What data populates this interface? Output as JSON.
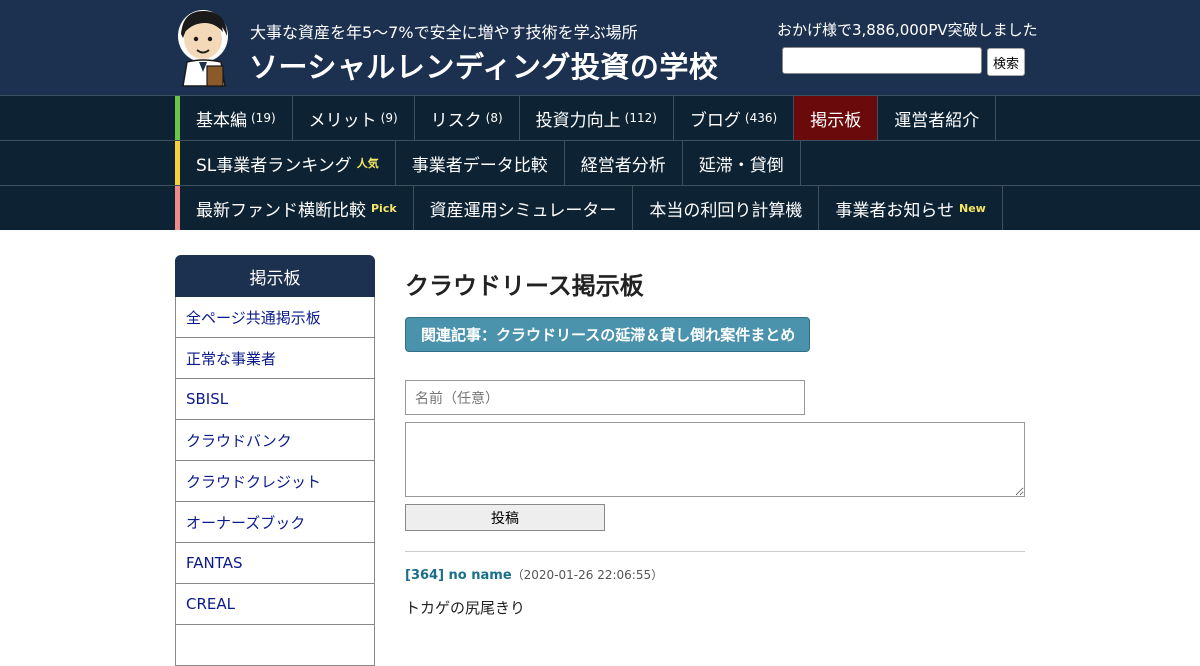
{
  "header": {
    "tagline": "大事な資産を年5～7%で安全に増やす技術を学ぶ場所",
    "site_title": "ソーシャルレンディング投資の学校",
    "pv_text": "おかげ様で3,886,000PV突破しました",
    "search_button": "検索",
    "search_value": ""
  },
  "nav": {
    "row1": [
      {
        "label": "基本編",
        "count": "(19)"
      },
      {
        "label": "メリット",
        "count": "(9)"
      },
      {
        "label": "リスク",
        "count": "(8)"
      },
      {
        "label": "投資力向上",
        "count": "(112)"
      },
      {
        "label": "ブログ",
        "count": "(436)"
      },
      {
        "label": "掲示板",
        "count": ""
      },
      {
        "label": "運営者紹介",
        "count": ""
      }
    ],
    "row2": [
      {
        "label": "SL事業者ランキング",
        "tag": "人気"
      },
      {
        "label": "事業者データ比較",
        "tag": ""
      },
      {
        "label": "経営者分析",
        "tag": ""
      },
      {
        "label": "延滞・貸倒",
        "tag": ""
      }
    ],
    "row3": [
      {
        "label": "最新ファンド横断比較",
        "tag": "Pick"
      },
      {
        "label": "資産運用シミュレーター",
        "tag": ""
      },
      {
        "label": "本当の利回り計算機",
        "tag": ""
      },
      {
        "label": "事業者お知らせ",
        "tag": "New"
      }
    ],
    "stripe_colors": [
      "#6cc24a",
      "#f2d13a",
      "#f08a8a"
    ],
    "active_color": "#6a0a0a"
  },
  "sidebar": {
    "title": "掲示板",
    "items": [
      "全ページ共通掲示板",
      "正常な事業者",
      "SBISL",
      "クラウドバンク",
      "クラウドクレジット",
      "オーナーズブック",
      "FANTAS",
      "CREAL"
    ]
  },
  "main": {
    "title": "クラウドリース掲示板",
    "related_link": "関連記事：クラウドリースの延滞＆貸し倒れ案件まとめ",
    "name_placeholder": "名前（任意）",
    "post_button": "投稿"
  },
  "post": {
    "author": "[364] no name",
    "date": "（2020-01-26 22:06:55）",
    "body": "トカゲの尻尾きり"
  }
}
